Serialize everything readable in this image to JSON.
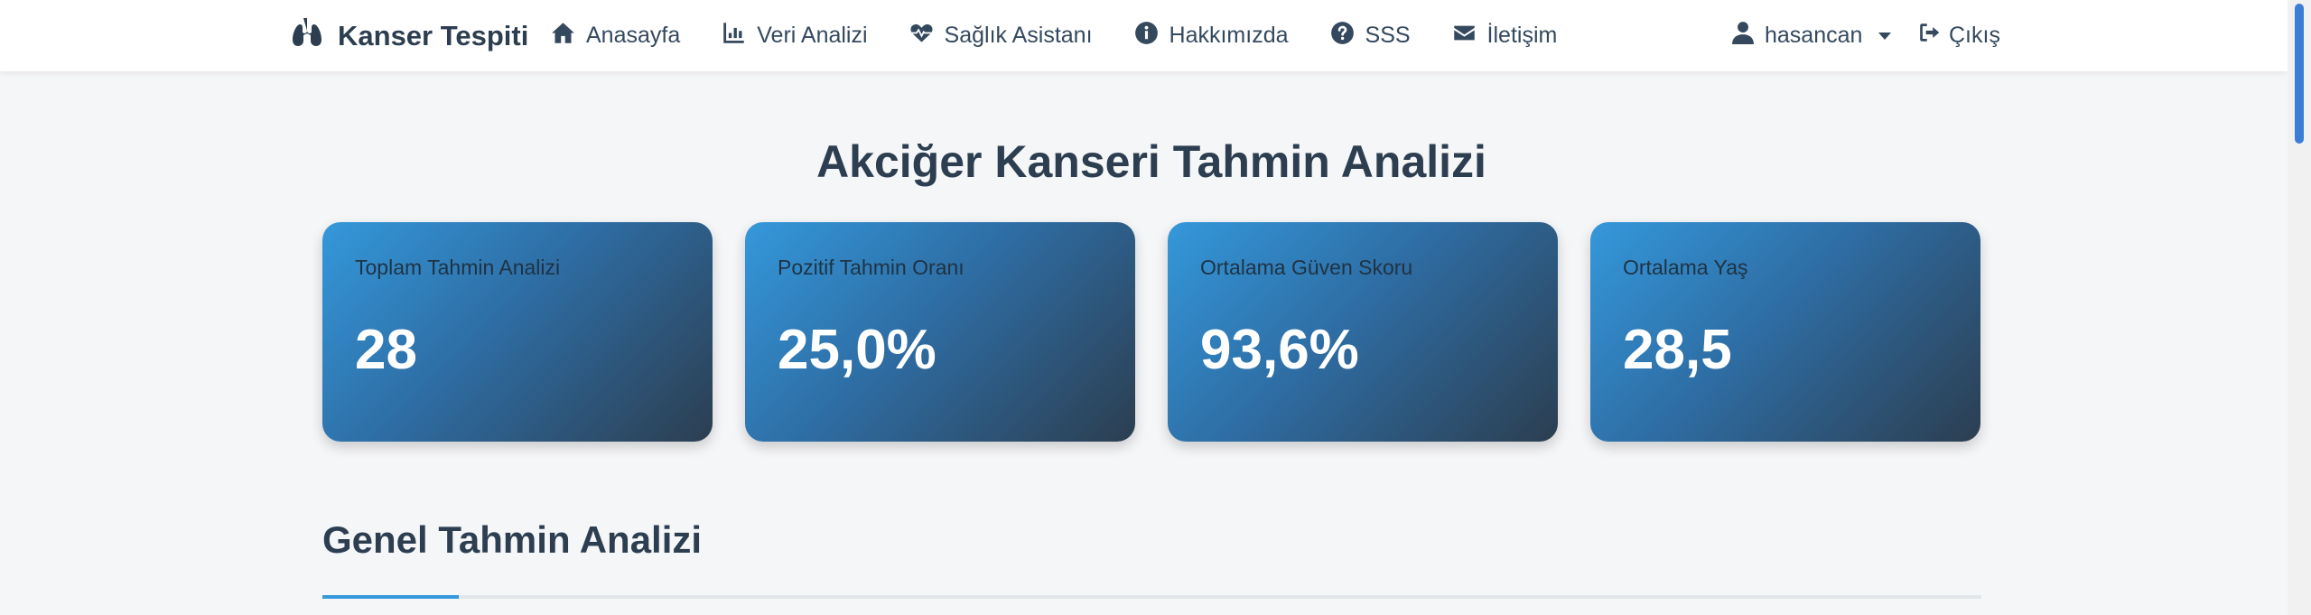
{
  "brand": {
    "name": "Kanser Tespiti",
    "icon": "lungs-icon"
  },
  "nav": {
    "items": [
      {
        "label": "Anasayfa",
        "icon": "home-icon"
      },
      {
        "label": "Veri Analizi",
        "icon": "chart-icon"
      },
      {
        "label": "Sağlık Asistanı",
        "icon": "heartbeat-icon"
      },
      {
        "label": "Hakkımızda",
        "icon": "info-icon"
      },
      {
        "label": "SSS",
        "icon": "question-icon"
      },
      {
        "label": "İletişim",
        "icon": "envelope-icon"
      }
    ],
    "user": {
      "name": "hasancan",
      "icon": "user-icon"
    },
    "logout": {
      "label": "Çıkış",
      "icon": "sign-out-icon"
    }
  },
  "page": {
    "title": "Akciğer Kanseri Tahmin Analizi"
  },
  "stats": [
    {
      "label": "Toplam Tahmin Analizi",
      "value": "28"
    },
    {
      "label": "Pozitif Tahmin Oranı",
      "value": "25,0%"
    },
    {
      "label": "Ortalama Güven Skoru",
      "value": "93,6%"
    },
    {
      "label": "Ortalama Yaş",
      "value": "28,5"
    }
  ],
  "section": {
    "title": "Genel Tahmin Analizi"
  },
  "colors": {
    "accent": "#3498db",
    "dark": "#2c3e50"
  }
}
